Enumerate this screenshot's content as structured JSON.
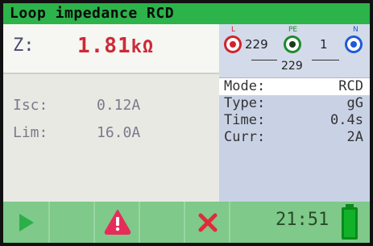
{
  "title": "Loop impedance RCD",
  "z": {
    "label": "Z:",
    "value": "1.81",
    "unit": "kΩ"
  },
  "isc": {
    "label": "Isc:",
    "value": "0.12A"
  },
  "lim": {
    "label": "Lim:",
    "value": "16.0A"
  },
  "terminals": {
    "l": {
      "tag": "L",
      "color": "#d2232a"
    },
    "pe": {
      "tag": "PE",
      "color": "#1e8a2e"
    },
    "n": {
      "tag": "N",
      "color": "#1e5ad8"
    },
    "v_l_pe": "229",
    "v_pe_n": "1",
    "v_l_n": "229"
  },
  "settings": [
    {
      "key": "Mode:",
      "value": "RCD"
    },
    {
      "key": "Type:",
      "value": "gG"
    },
    {
      "key": "Time:",
      "value": "0.4s"
    },
    {
      "key": "Curr:",
      "value": "2A"
    }
  ],
  "bottom": {
    "start_icon": "play-icon",
    "warning_icon": "warning-icon",
    "error_icon": "close-icon",
    "clock": "21:51",
    "battery_icon": "battery-full-icon",
    "battery_level": 1.0
  }
}
